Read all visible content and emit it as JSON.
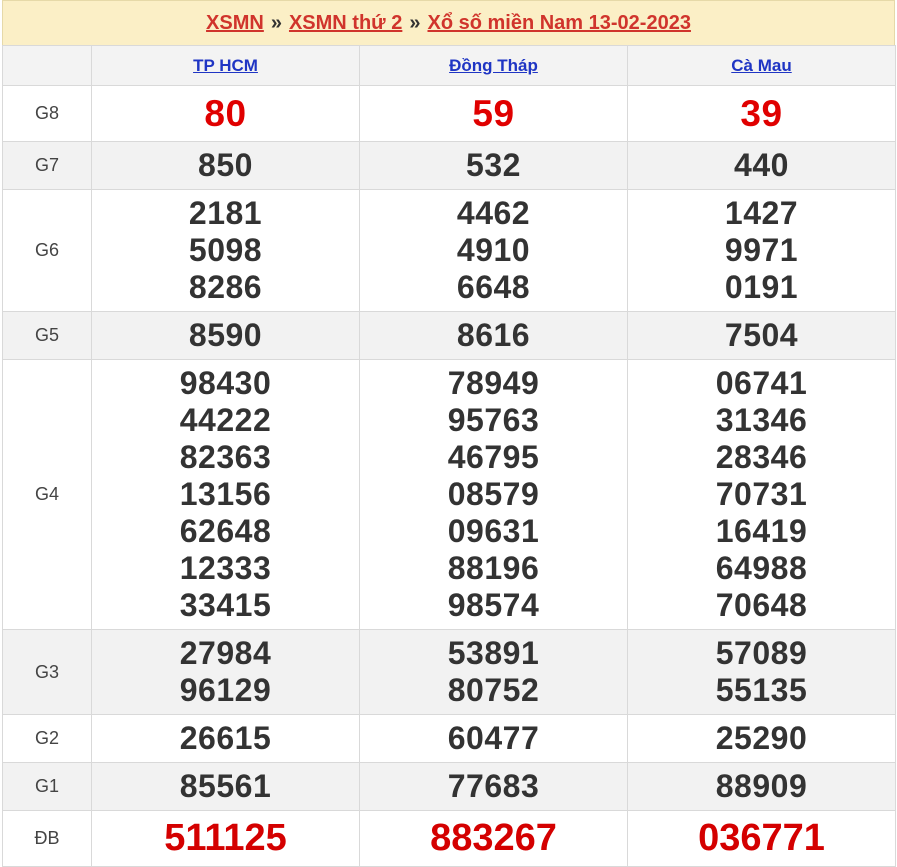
{
  "breadcrumb": {
    "link1": "XSMN",
    "sep": "»",
    "link2": "XSMN thứ 2",
    "link3": "Xổ số miền Nam 13-02-2023"
  },
  "provinces": [
    "TP HCM",
    "Đồng Tháp",
    "Cà Mau"
  ],
  "prizes": [
    {
      "label": "G8",
      "values": [
        [
          "80"
        ],
        [
          "59"
        ],
        [
          "39"
        ]
      ]
    },
    {
      "label": "G7",
      "values": [
        [
          "850"
        ],
        [
          "532"
        ],
        [
          "440"
        ]
      ]
    },
    {
      "label": "G6",
      "values": [
        [
          "2181",
          "5098",
          "8286"
        ],
        [
          "4462",
          "4910",
          "6648"
        ],
        [
          "1427",
          "9971",
          "0191"
        ]
      ]
    },
    {
      "label": "G5",
      "values": [
        [
          "8590"
        ],
        [
          "8616"
        ],
        [
          "7504"
        ]
      ]
    },
    {
      "label": "G4",
      "values": [
        [
          "98430",
          "44222",
          "82363",
          "13156",
          "62648",
          "12333",
          "33415"
        ],
        [
          "78949",
          "95763",
          "46795",
          "08579",
          "09631",
          "88196",
          "98574"
        ],
        [
          "06741",
          "31346",
          "28346",
          "70731",
          "16419",
          "64988",
          "70648"
        ]
      ]
    },
    {
      "label": "G3",
      "values": [
        [
          "27984",
          "96129"
        ],
        [
          "53891",
          "80752"
        ],
        [
          "57089",
          "55135"
        ]
      ]
    },
    {
      "label": "G2",
      "values": [
        [
          "26615"
        ],
        [
          "60477"
        ],
        [
          "25290"
        ]
      ]
    },
    {
      "label": "G1",
      "values": [
        [
          "85561"
        ],
        [
          "77683"
        ],
        [
          "88909"
        ]
      ]
    },
    {
      "label": "ĐB",
      "values": [
        [
          "511125"
        ],
        [
          "883267"
        ],
        [
          "036771"
        ]
      ]
    }
  ],
  "colors": {
    "accent_red": "#e00000",
    "link_blue": "#1f35c4",
    "title_bg": "#fbefc6"
  }
}
